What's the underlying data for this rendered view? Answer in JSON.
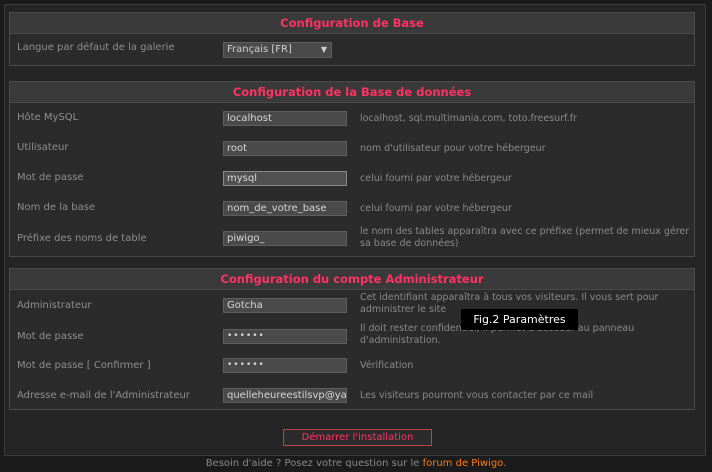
{
  "base": {
    "title": "Configuration de Base",
    "language_label": "Langue par défaut de la galerie",
    "language_value": "Français [FR]"
  },
  "db": {
    "title": "Configuration de la Base de données",
    "rows": [
      {
        "label": "Hôte MySQL",
        "value": "localhost",
        "hint": "localhost, sql.multimania.com, toto.freesurf.fr"
      },
      {
        "label": "Utilisateur",
        "value": "root",
        "hint": "nom d'utilisateur pour votre hébergeur"
      },
      {
        "label": "Mot de passe",
        "value": "mysql",
        "hint": "celui fourni par votre hébergeur"
      },
      {
        "label": "Nom de la base",
        "value": "nom_de_votre_base",
        "hint": "celui fourni par votre hébergeur"
      },
      {
        "label": "Préfixe des noms de table",
        "value": "piwigo_",
        "hint": "le nom des tables apparaîtra avec ce préfixe (permet de mieux gérer sa base de données)"
      }
    ]
  },
  "admin": {
    "title": "Configuration du compte Administrateur",
    "rows": [
      {
        "label": "Administrateur",
        "value": "Gotcha",
        "hint": "Cet identifiant apparaîtra à tous vos visiteurs. Il vous sert pour administrer le site"
      },
      {
        "label": "Mot de passe",
        "value": "••••••",
        "hint": "Il doit rester confidentiel, il permet d'accéder au panneau d'administration."
      },
      {
        "label": "Mot de passe [ Confirmer ]",
        "value": "••••••",
        "hint": "Vérification"
      },
      {
        "label": "Adresse e-mail de l'Administrateur",
        "value": "quelleheureestilsvp@yahoo.fr",
        "hint": "Les visiteurs pourront vous contacter par ce mail"
      }
    ]
  },
  "submit_label": "Démarrer l'installation",
  "footer": {
    "text": "Besoin d'aide ? Posez votre question sur le ",
    "link": "forum de Piwigo",
    "end": "."
  },
  "tooltip": "Fig.2 Paramètres"
}
